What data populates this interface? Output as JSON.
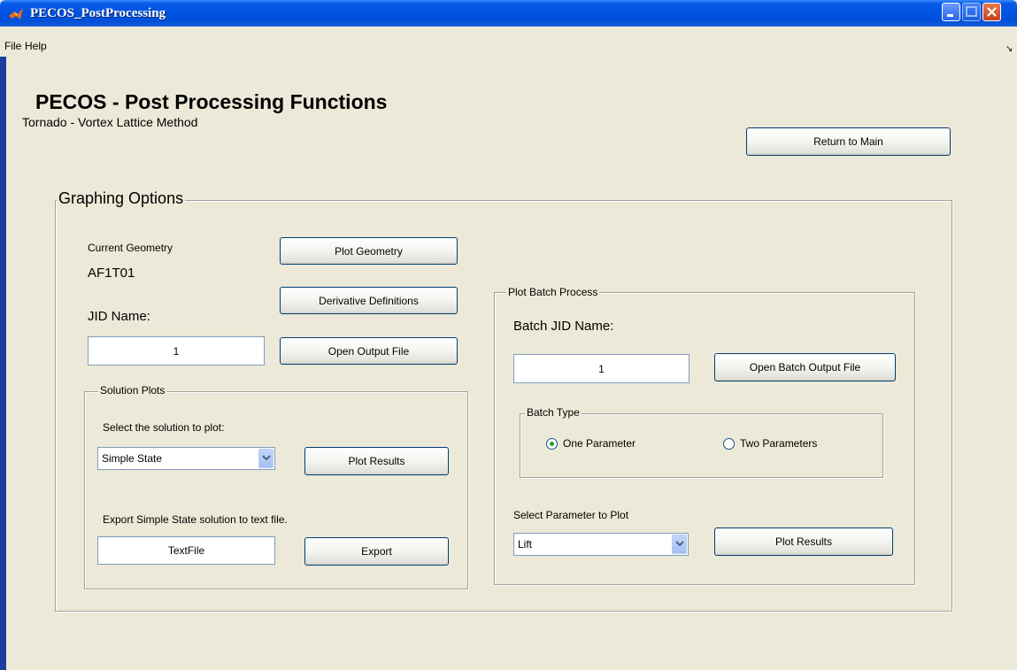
{
  "window": {
    "title": "PECOS_PostProcessing"
  },
  "menu": {
    "file": "File",
    "help": "Help",
    "arrow": "↘"
  },
  "header": {
    "title": "PECOS - Post Processing Functions",
    "subtitle": "Tornado - Vortex Lattice Method",
    "return_button": "Return to Main"
  },
  "graphing": {
    "title": "Graphing Options",
    "current_geometry_label": "Current Geometry",
    "current_geometry_value": "AF1T01",
    "plot_geometry_button": "Plot Geometry",
    "derivative_definitions_button": "Derivative Definitions",
    "jid_label": "JID Name:",
    "jid_value": "1",
    "open_output_button": "Open Output File"
  },
  "solution_plots": {
    "title": "Solution Plots",
    "select_label": "Select the solution to plot:",
    "selected": "Simple State",
    "plot_results_button": "Plot Results",
    "export_label": "Export Simple State solution to text file.",
    "export_filename": "TextFile",
    "export_button": "Export"
  },
  "batch": {
    "title": "Plot Batch Process",
    "jid_label": "Batch JID Name:",
    "jid_value": "1",
    "open_button": "Open Batch Output File",
    "batch_type_title": "Batch Type",
    "option_one": "One Parameter",
    "option_two": "Two Parameters",
    "selected_option": "One Parameter",
    "param_label": "Select Parameter to Plot",
    "param_selected": "Lift",
    "plot_results_button": "Plot Results"
  },
  "colors": {
    "titlebar": "#0054e3",
    "window_bg": "#ece9d8",
    "radio_selected": "#21a121"
  }
}
